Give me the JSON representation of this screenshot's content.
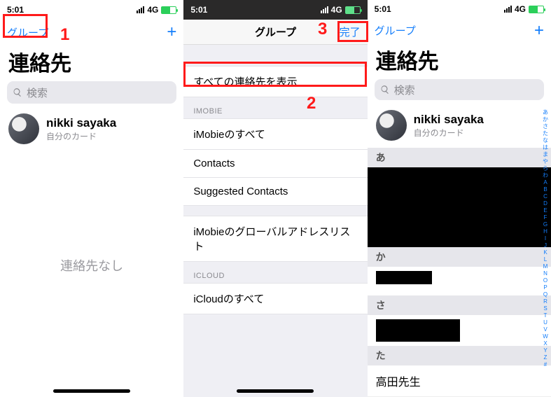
{
  "status": {
    "time": "5:01",
    "net": "4G"
  },
  "pane1": {
    "nav_left": "グループ",
    "title": "連絡先",
    "search_placeholder": "検索",
    "me_name": "nikki sayaka",
    "me_sub": "自分のカード",
    "empty": "連絡先なし"
  },
  "pane2": {
    "nav_center": "グループ",
    "nav_right": "完了",
    "all": "すべての連絡先を表示",
    "sec1_head": "IMOBIE",
    "sec1_items": [
      "iMobieのすべて",
      "Contacts",
      "Suggested Contacts"
    ],
    "sec1_extra": "iMobieのグローバルアドレスリスト",
    "sec2_head": "ICLOUD",
    "sec2_items": [
      "iCloudのすべて"
    ]
  },
  "pane3": {
    "nav_left": "グループ",
    "title": "連絡先",
    "search_placeholder": "検索",
    "me_name": "nikki sayaka",
    "me_sub": "自分のカード",
    "sec_a": "あ",
    "sec_ka": "か",
    "sec_sa": "さ",
    "sec_ta": "た",
    "row_ta1": "高田先生",
    "index": [
      "あ",
      "か",
      "さ",
      "た",
      "な",
      "は",
      "ま",
      "や",
      "ら",
      "わ",
      "A",
      "B",
      "C",
      "D",
      "E",
      "F",
      "G",
      "H",
      "I",
      "J",
      "K",
      "L",
      "M",
      "N",
      "O",
      "P",
      "Q",
      "R",
      "S",
      "T",
      "U",
      "V",
      "W",
      "X",
      "Y",
      "Z",
      "#"
    ]
  },
  "anno": {
    "n1": "1",
    "n2": "2",
    "n3": "3"
  }
}
